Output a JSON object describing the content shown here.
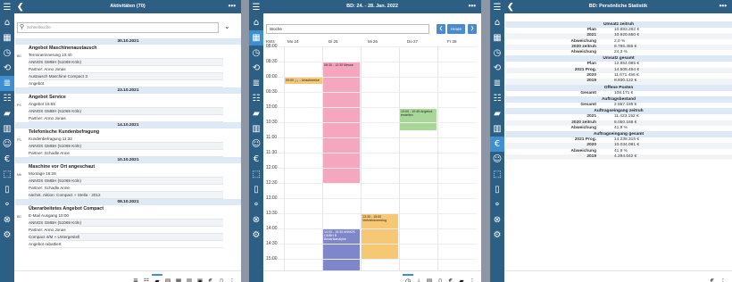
{
  "rail_icons": [
    "menu-icon",
    "home-icon",
    "calendar-icon",
    "clock-icon",
    "user-sync-icon",
    "list-icon",
    "contacts-icon",
    "folder-icon",
    "building-icon",
    "people-icon",
    "euro-icon",
    "box-icon",
    "doc-icon",
    "route-icon",
    "cancel-icon",
    "gear-icon"
  ],
  "p1": {
    "title": "Aktivitäten (70)",
    "search_placeholder": "Schnellsuche",
    "groups": [
      {
        "date": "30.10.2021",
        "items": [
          {
            "kind": "BD",
            "title": "Angebot Maschinenaustausch",
            "lines": [
              "Terminerinnerung 10:40",
              "ANNOS GMBH (51069 Köln)",
              "Partner: Anno Jonas",
              "Austausch Maschine Compact 3",
              "Angebot"
            ]
          }
        ]
      },
      {
        "date": "23.10.2021",
        "items": [
          {
            "kind": "PS",
            "title": "Angebot Service",
            "lines": [
              "Angebot 15:55",
              "ANNOS GMBH (51069 Köln)",
              "Partner: Anno Jonas"
            ]
          }
        ]
      },
      {
        "date": "14.10.2021",
        "items": [
          {
            "kind": "PS",
            "title": "Telefonische Kundenbefragung",
            "lines": [
              "Kundenbefragung 11:32",
              "ANNOS GMBH (51069 Köln)",
              "Partner: Schadle Anne"
            ]
          }
        ]
      },
      {
        "date": "10.10.2021",
        "items": [
          {
            "kind": "MK",
            "title": "Maschine vor Ort angeschaut",
            "lines": [
              "Montage 16:28",
              "ANNOS GMBH (51069 Köln)",
              "Partner: Schadle Anne",
              "nächst. Aktion: Compact + Stella - 2012"
            ]
          }
        ]
      },
      {
        "date": "08.10.2021",
        "items": [
          {
            "kind": "BD",
            "title": "Überarbeitetes Angebot Compact",
            "lines": [
              "E-Mail Ausgang 10:00",
              "ANNOS GMBH (51069 Köln)",
              "Partner: Anno Jonas",
              "Compact 4/M + Untergestell",
              "Angebot rabattiert"
            ]
          }
        ]
      }
    ]
  },
  "p2": {
    "title": "BD: 24. - 28. Jan. 2022",
    "view": "Woche",
    "today": "Heute",
    "kw": "KW4",
    "days": [
      "Mo 24",
      "Di 25",
      "Mi 26",
      "Do 27",
      "Fr 28"
    ],
    "times": [
      "08:00",
      "08:30",
      "09:00",
      "09:30",
      "10:00",
      "10:30",
      "11:00",
      "11:30",
      "12:00",
      "12:30",
      "13:00",
      "13:30",
      "14:00",
      "14:30",
      "15:00"
    ],
    "events": [
      {
        "text": "08:30 - 12:30 Messe",
        "color": "#f4a7bf"
      },
      {
        "text": "09:00 🚑 - Urlaubsreise",
        "color": "#f7c873"
      },
      {
        "text": "10:00 - 10:45 Angebot erstellen",
        "color": "#a9d79a"
      },
      {
        "text": "13:30 - 15:00 Vertriebsmeeting",
        "color": "#f7c873"
      },
      {
        "text": "14:00 - 15:30 ANNOS GMBH B Bedarfsanalyse",
        "color": "#7f86c9"
      }
    ]
  },
  "p3": {
    "title": "BD: Persönliche Statistik",
    "sections": [
      {
        "head": "Umsatz zeitruh",
        "rows": [
          [
            "Plan",
            "10.883.282 €"
          ],
          [
            "2021",
            "10.920.650 €"
          ],
          [
            "Abweichung",
            "2,0 %"
          ],
          [
            "2020 zeitruh",
            "8.785.456 €"
          ],
          [
            "Abweichung",
            "24,3 %"
          ]
        ]
      },
      {
        "head": "Umsatz gesamt",
        "rows": [
          [
            "Plan",
            "12.854.085 €"
          ],
          [
            "2021 Prog.",
            "14.508.454 €"
          ],
          [
            "2020",
            "11.671.456 €"
          ],
          [
            "2019",
            "8.930.122 €"
          ]
        ]
      },
      {
        "head": "Offene Posten",
        "rows": [
          [
            "Gesamt",
            "108.171 €"
          ]
        ]
      },
      {
        "head": "Auftragsbestand",
        "rows": [
          [
            "Gesamt",
            "2.867.185 €"
          ]
        ]
      },
      {
        "head": "Auftragseingang zeitruh",
        "rows": [
          [
            "2021",
            "11.423.152 €"
          ],
          [
            "2020 zeitruh",
            "8.050.168 €"
          ],
          [
            "Abweichung",
            "41,9 %"
          ]
        ]
      },
      {
        "head": "Auftragseingang gesamt",
        "rows": [
          [
            "2021 Prog.",
            "14.238.315 €"
          ],
          [
            "2020",
            "10.034.081 €"
          ],
          [
            "Abweichung",
            "41,9 %"
          ],
          [
            "2019",
            "4.294.042 €"
          ]
        ]
      }
    ]
  }
}
